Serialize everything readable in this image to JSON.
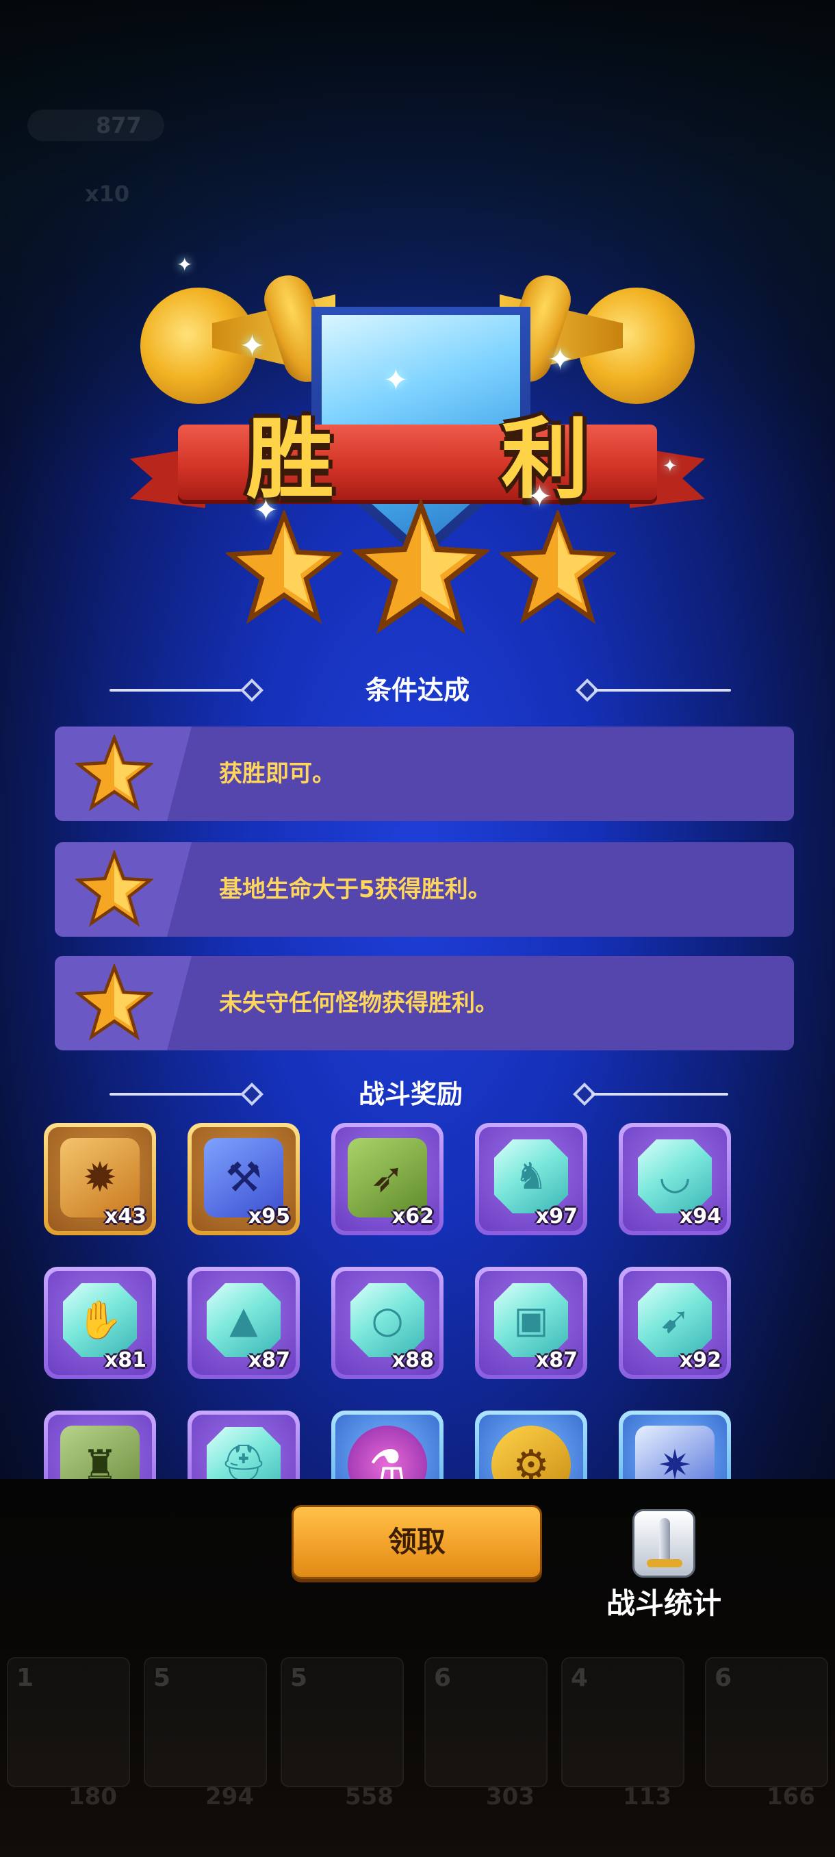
{
  "title": "胜 利",
  "conditions_header": "条件达成",
  "conditions": [
    {
      "text": "获胜即可。"
    },
    {
      "text": "基地生命大于5获得胜利。"
    },
    {
      "text": "未失守任何怪物获得胜利。"
    }
  ],
  "rewards_header": "战斗奖励",
  "rewards": [
    {
      "qty": "x43",
      "frame": "gold",
      "icon": "puzzle-fire-icon"
    },
    {
      "qty": "x95",
      "frame": "gold",
      "icon": "puzzle-hammer-icon"
    },
    {
      "qty": "x62",
      "frame": "purple",
      "icon": "puzzle-crossbow-icon"
    },
    {
      "qty": "x97",
      "frame": "purple",
      "icon": "gem-boot-icon"
    },
    {
      "qty": "x94",
      "frame": "purple",
      "icon": "gem-necklace-icon"
    },
    {
      "qty": "x81",
      "frame": "purple",
      "icon": "gem-glove-icon"
    },
    {
      "qty": "x87",
      "frame": "purple",
      "icon": "gem-cape-icon"
    },
    {
      "qty": "x88",
      "frame": "purple",
      "icon": "gem-ring-icon"
    },
    {
      "qty": "x87",
      "frame": "purple",
      "icon": "gem-shirt-icon"
    },
    {
      "qty": "x92",
      "frame": "purple",
      "icon": "gem-bow-icon"
    },
    {
      "qty": "",
      "frame": "purple",
      "icon": "puzzle-tower-icon"
    },
    {
      "qty": "",
      "frame": "purple",
      "icon": "gem-helmet-icon"
    },
    {
      "qty": "",
      "frame": "blue",
      "icon": "potion-icon"
    },
    {
      "qty": "",
      "frame": "blue",
      "icon": "gear-icon"
    },
    {
      "qty": "",
      "frame": "blue",
      "icon": "crystal-icon"
    }
  ],
  "claim_label": "领取",
  "stats_label": "战斗统计",
  "background_hud": {
    "coins": "877",
    "multiplier": "x10",
    "cards": [
      {
        "level": "1",
        "cost": "180"
      },
      {
        "level": "5",
        "cost": "294"
      },
      {
        "level": "5",
        "cost": "558"
      },
      {
        "level": "6",
        "cost": "303"
      },
      {
        "level": "4",
        "cost": "113"
      },
      {
        "level": "6",
        "cost": "166"
      }
    ]
  },
  "colors": {
    "accent_gold": "#ffd347",
    "ribbon_red": "#d33527",
    "panel_purple": "#5446ad",
    "button_orange": "#f2a22a"
  }
}
